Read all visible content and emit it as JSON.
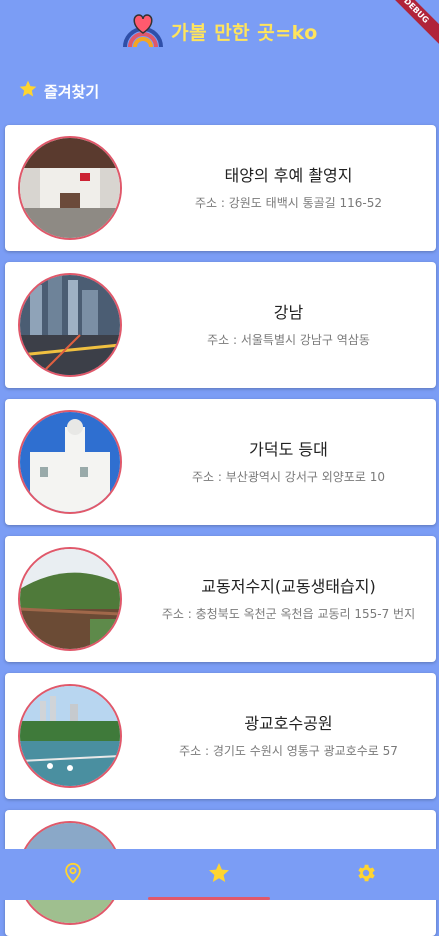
{
  "app": {
    "title": "가볼 만한 곳=ko",
    "debug_label": "DEBUG"
  },
  "section": {
    "label": "즐겨찾기",
    "icon": "star-icon"
  },
  "places": [
    {
      "name": "태양의 후예 촬영지",
      "address": "주소 : 강원도 태백시 통골길 116-52"
    },
    {
      "name": "강남",
      "address": "주소 : 서울특별시 강남구 역삼동"
    },
    {
      "name": "가덕도 등대",
      "address": "주소 : 부산광역시 강서구 외양포로 10"
    },
    {
      "name": "교동저수지(교동생태습지)",
      "address": "주소 : 충청북도 옥천군 옥천읍 교동리 155-7 번지"
    },
    {
      "name": "광교호수공원",
      "address": "주소 : 경기도 수원시 영통구 광교호수로 57"
    },
    {
      "name": "",
      "address": ""
    }
  ],
  "nav": {
    "items": [
      "location-pin-icon",
      "star-icon",
      "gear-icon"
    ],
    "selected": "star-icon"
  },
  "colors": {
    "background": "#7b9df5",
    "title": "#ffe45c",
    "accent": "#e0586a",
    "star": "#ffd530"
  }
}
